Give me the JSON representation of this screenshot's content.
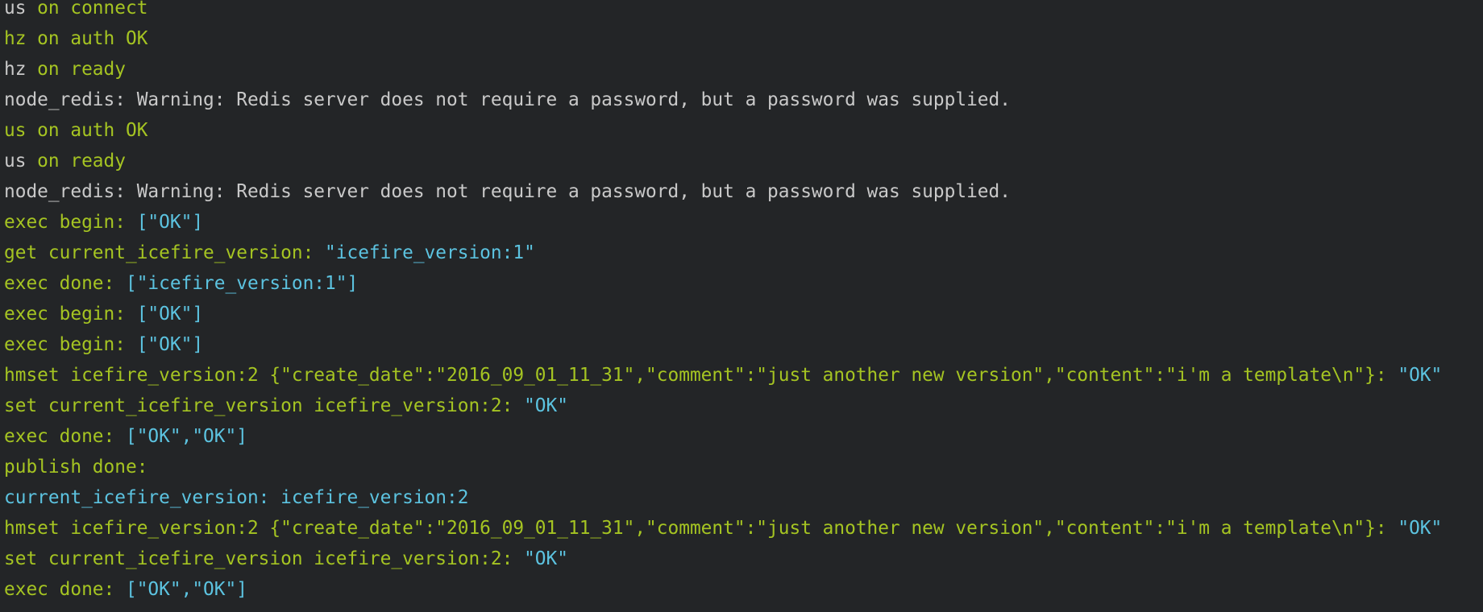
{
  "colors": {
    "background": "#232527",
    "gray": "#c9c9c9",
    "green": "#a5c422",
    "cyan": "#5cc3e0"
  },
  "terminal": {
    "lines": [
      [
        {
          "t": "us",
          "c": "gray"
        },
        {
          "t": " on connect",
          "c": "green"
        }
      ],
      [
        {
          "t": "hz on auth OK",
          "c": "green"
        }
      ],
      [
        {
          "t": "hz",
          "c": "gray"
        },
        {
          "t": " on ready",
          "c": "green"
        }
      ],
      [
        {
          "t": "node_redis: Warning: Redis server does not require a password, but a password was supplied.",
          "c": "gray"
        }
      ],
      [
        {
          "t": "us on auth OK",
          "c": "green"
        }
      ],
      [
        {
          "t": "us",
          "c": "gray"
        },
        {
          "t": " on ready",
          "c": "green"
        }
      ],
      [
        {
          "t": "node_redis: Warning: Redis server does not require a password, but a password was supplied.",
          "c": "gray"
        }
      ],
      [
        {
          "t": "exec begin: ",
          "c": "green"
        },
        {
          "t": "[\"OK\"]",
          "c": "cyan"
        }
      ],
      [
        {
          "t": "get current_icefire_version: ",
          "c": "green"
        },
        {
          "t": "\"icefire_version:1\"",
          "c": "cyan"
        }
      ],
      [
        {
          "t": "exec done: ",
          "c": "green"
        },
        {
          "t": "[\"icefire_version:1\"]",
          "c": "cyan"
        }
      ],
      [
        {
          "t": "exec begin: ",
          "c": "green"
        },
        {
          "t": "[\"OK\"]",
          "c": "cyan"
        }
      ],
      [
        {
          "t": "exec begin: ",
          "c": "green"
        },
        {
          "t": "[\"OK\"]",
          "c": "cyan"
        }
      ],
      [
        {
          "t": "hmset icefire_version:2 {\"create_date\":\"2016_09_01_11_31\",\"comment\":\"just another new version\",\"content\":\"i'm a template\\n\"}: ",
          "c": "green"
        },
        {
          "t": "\"OK\"",
          "c": "cyan"
        }
      ],
      [
        {
          "t": "set current_icefire_version icefire_version:2: ",
          "c": "green"
        },
        {
          "t": "\"OK\"",
          "c": "cyan"
        }
      ],
      [
        {
          "t": "exec done: ",
          "c": "green"
        },
        {
          "t": "[\"OK\",\"OK\"]",
          "c": "cyan"
        }
      ],
      [
        {
          "t": "publish done:",
          "c": "green"
        }
      ],
      [
        {
          "t": "current_icefire_version: icefire_version:2",
          "c": "cyan"
        }
      ],
      [
        {
          "t": "hmset icefire_version:2 {\"create_date\":\"2016_09_01_11_31\",\"comment\":\"just another new version\",\"content\":\"i'm a template\\n\"}: ",
          "c": "green"
        },
        {
          "t": "\"OK\"",
          "c": "cyan"
        }
      ],
      [
        {
          "t": "set current_icefire_version icefire_version:2: ",
          "c": "green"
        },
        {
          "t": "\"OK\"",
          "c": "cyan"
        }
      ],
      [
        {
          "t": "exec done: ",
          "c": "green"
        },
        {
          "t": "[\"OK\",\"OK\"]",
          "c": "cyan"
        }
      ]
    ]
  }
}
